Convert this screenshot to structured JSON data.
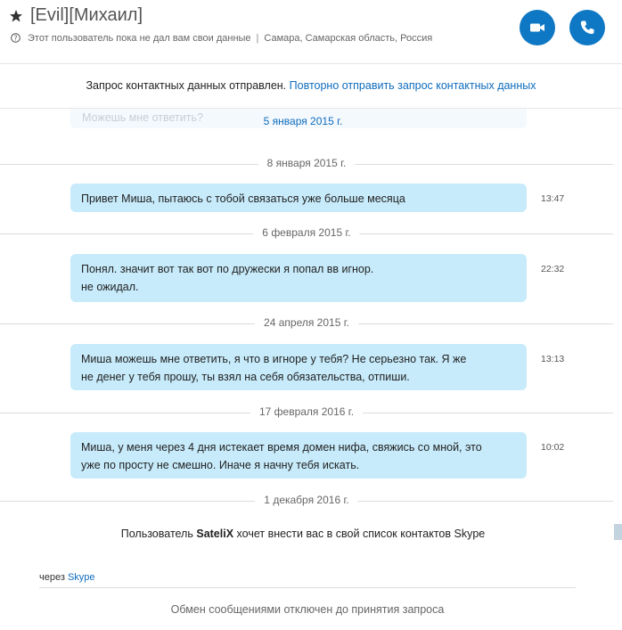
{
  "header": {
    "contact_name": "[Evil][Михаил]",
    "status_text": "Этот пользователь пока не дал вам свои данные",
    "separator": "|",
    "location": "Самара, Самарская область, Россия",
    "accent_color": "#0f78c4",
    "icons": {
      "favorite": "star-icon",
      "info": "info-icon",
      "video": "video-camera-icon",
      "call": "phone-icon"
    }
  },
  "notice": {
    "text": "Запрос контактных данных отправлен.",
    "link": "Повторно отправить запрос контактных данных"
  },
  "conversation": {
    "ghost_text": "Можешь мне ответить?",
    "floating_date": "5 января 2015 г.",
    "groups": [
      {
        "date": "8 января 2015 г.",
        "time": "13:47",
        "lines": [
          "Привет Миша, пытаюсь с тобой связаться уже больше месяца"
        ]
      },
      {
        "date": "6 февраля 2015 г.",
        "time": "22:32",
        "lines": [
          "Понял. значит вот так вот по дружески я попал вв игнор.",
          "не ожидал."
        ]
      },
      {
        "date": "24 апреля 2015 г.",
        "time": "13:13",
        "lines": [
          "Миша можешь мне ответить, я что в игноре у тебя? Не серьезно так. Я же",
          "не денег у тебя прошу, ты взял на себя обязательства, отпиши."
        ]
      },
      {
        "date": "17 февраля 2016 г.",
        "time": "10:02",
        "lines": [
          "Миша, у меня через 4 дня истекает время домен нифа, свяжись со мной, это",
          "уже по просту не смешно. Иначе я начну тебя искать."
        ]
      }
    ],
    "last_date": "1 декабря 2016 г."
  },
  "contact_request": {
    "prefix": "Пользователь",
    "user": "SateliX",
    "suffix": "хочет внести вас в свой список контактов Skype"
  },
  "via": {
    "label": "через",
    "link": "Skype"
  },
  "footer": {
    "text": "Обмен сообщениями отключен до принятия запроса"
  },
  "colors": {
    "bubble": "#c7ebfb",
    "link": "#0f6cbd"
  }
}
